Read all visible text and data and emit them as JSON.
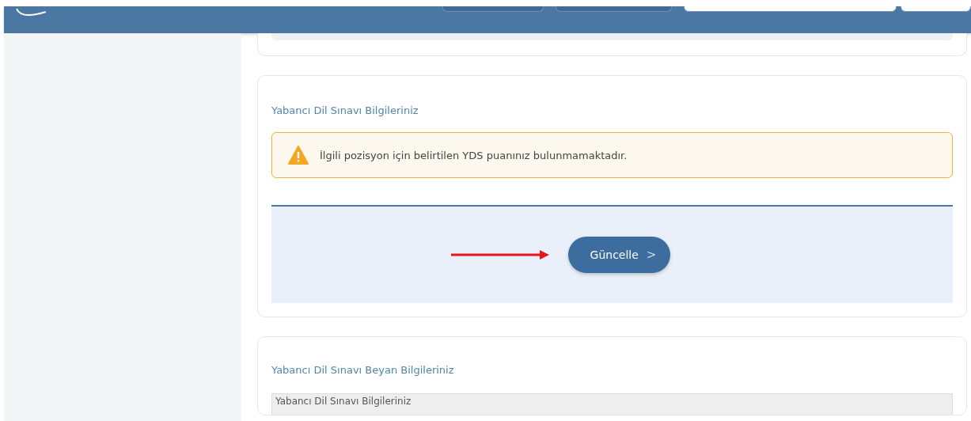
{
  "exam_section": {
    "title": "Yabancı Dil Sınavı Bilgileriniz",
    "alert": {
      "kind": "warning",
      "text": "İlgili pozisyon için belirtilen YDS puanınız bulunmamaktadır."
    },
    "update_button": {
      "label": "Güncelle",
      "caret": ">"
    }
  },
  "declaration_section": {
    "title": "Yabancı Dil Sınavı Beyan Bilgileriniz",
    "table_header": "Yabancı Dil Sınavı Bilgileriniz"
  }
}
